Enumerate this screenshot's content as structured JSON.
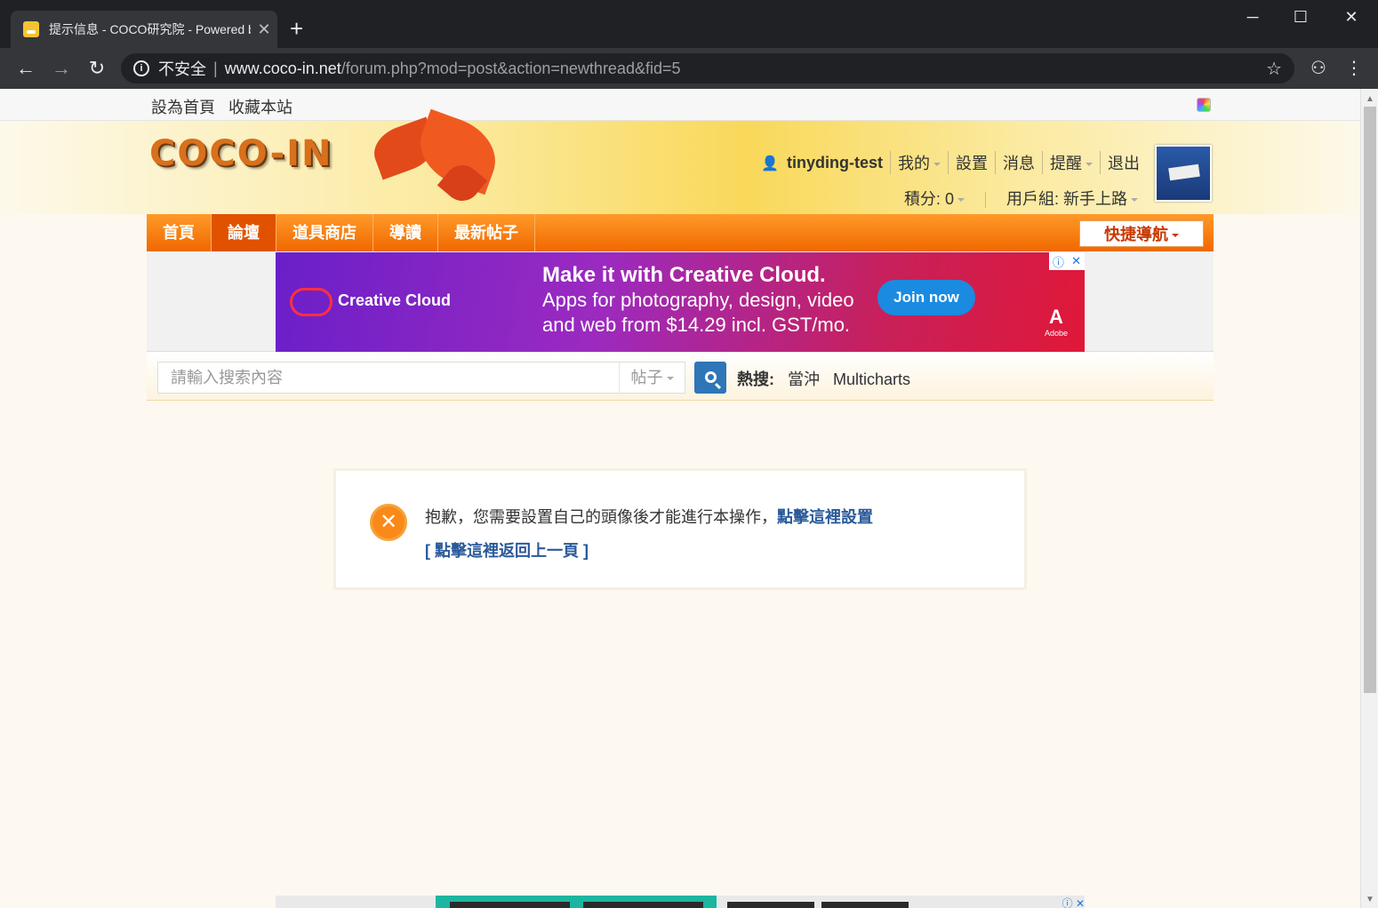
{
  "browser": {
    "tab_title": "提示信息 - COCO研究院 - Powered by Discuz!",
    "tab_close": "✕",
    "new_tab": "+",
    "minimize": "─",
    "maximize": "☐",
    "close": "✕",
    "back": "←",
    "forward": "→",
    "reload": "↻",
    "security_label": "不安全",
    "url_host": "www.coco-in.net",
    "url_path": "/forum.php?mod=post&action=newthread&fid=5",
    "bookmark_icon": "star-icon",
    "incognito_icon": "incognito-icon",
    "menu_icon": "⋮"
  },
  "topbar": {
    "set_home": "設為首頁",
    "bookmark_site": "收藏本站"
  },
  "header": {
    "logo_text": "COCO-IN",
    "username": "tinyding-test",
    "links": [
      "我的",
      "設置",
      "消息",
      "提醒",
      "退出"
    ],
    "credits": "積分: 0",
    "usergroup": "用戶組: 新手上路"
  },
  "nav": {
    "items": [
      "首頁",
      "論壇",
      "道具商店",
      "導讀",
      "最新帖子"
    ],
    "active": "論壇",
    "quick_nav": "快捷導航"
  },
  "ad": {
    "brand": "Creative Cloud",
    "headline": "Make it with Creative Cloud.",
    "sub": "Apps for photography, design, video and web from $14.29 incl. GST/mo.",
    "cta": "Join now",
    "adobe": "A",
    "adobe_small": "Adobe"
  },
  "search": {
    "placeholder": "請輸入搜索內容",
    "type": "帖子",
    "hot_label": "熱搜:",
    "hot_terms": [
      "當沖",
      "Multicharts"
    ]
  },
  "message": {
    "text": "抱歉，您需要設置自己的頭像後才能進行本操作，",
    "link": "點擊這裡設置",
    "back": "[ 點擊這裡返回上一頁 ]"
  },
  "colors": {
    "nav_orange": "#f06800",
    "link_blue": "#2a5a9a",
    "browser_dark": "#202124"
  }
}
